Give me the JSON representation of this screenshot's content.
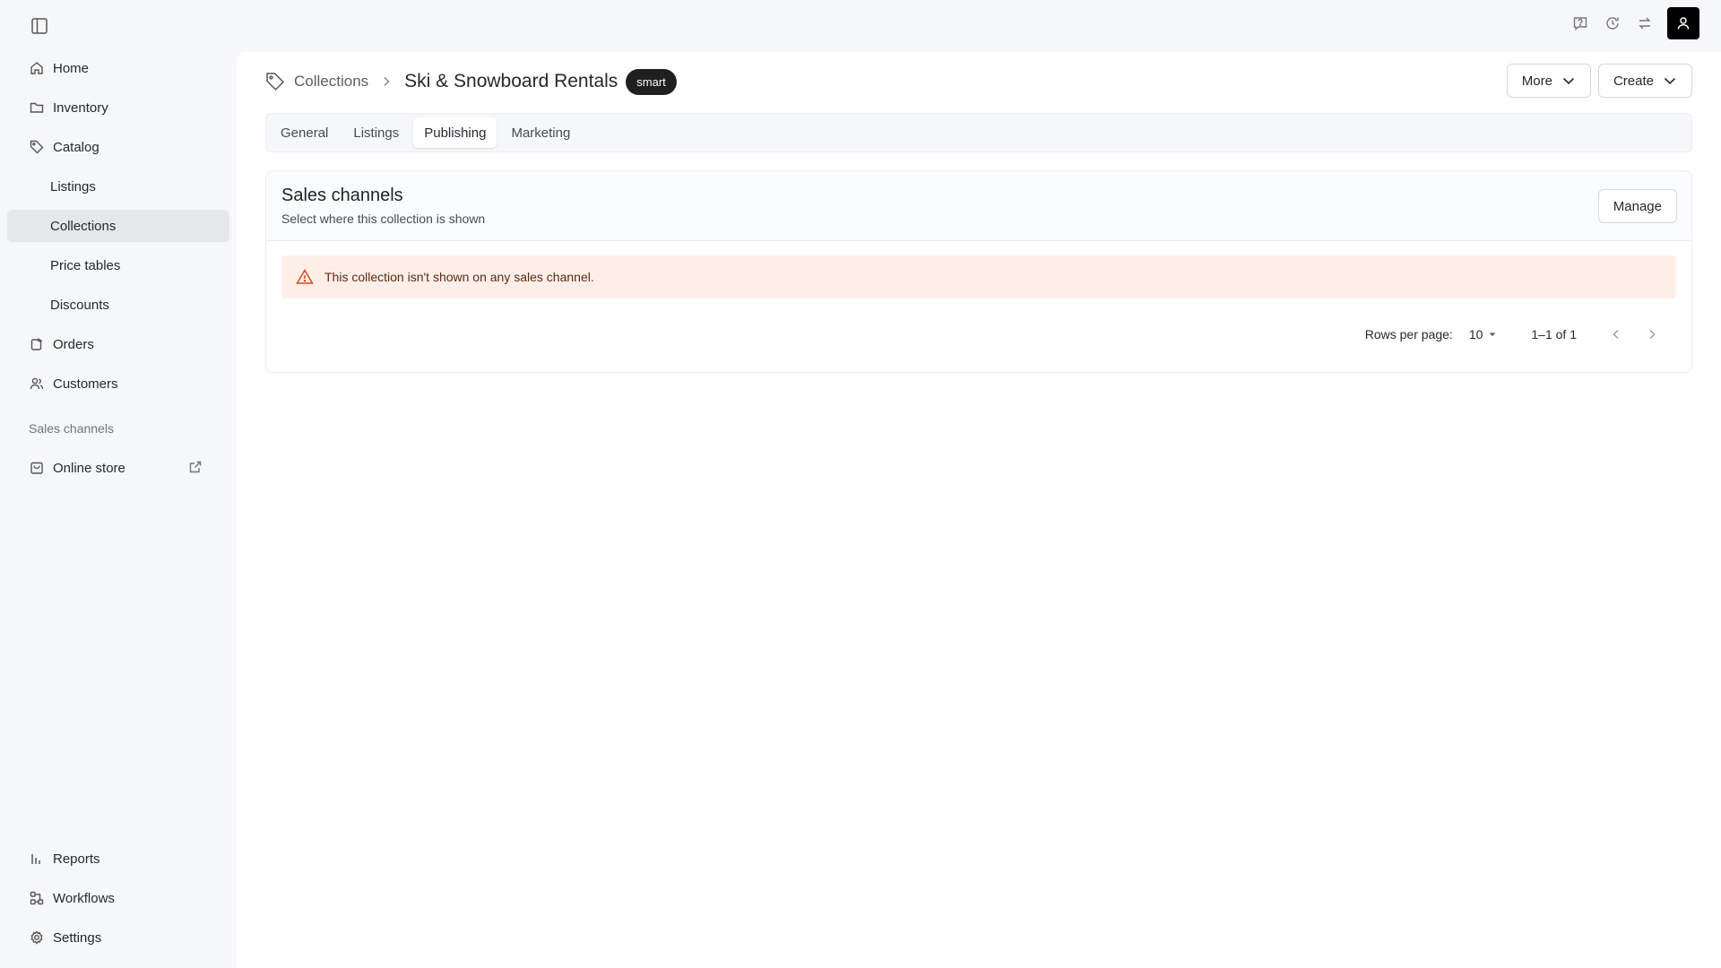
{
  "sidebar": {
    "items": [
      {
        "label": "Home",
        "icon": "home-icon"
      },
      {
        "label": "Inventory",
        "icon": "folder-icon"
      },
      {
        "label": "Catalog",
        "icon": "tag-icon"
      },
      {
        "label": "Listings"
      },
      {
        "label": "Collections",
        "active": true
      },
      {
        "label": "Price tables"
      },
      {
        "label": "Discounts"
      },
      {
        "label": "Orders",
        "icon": "orders-icon"
      },
      {
        "label": "Customers",
        "icon": "users-icon"
      }
    ],
    "section_label": "Sales channels",
    "online_store": "Online store",
    "bottom": [
      {
        "label": "Reports",
        "icon": "chart-icon"
      },
      {
        "label": "Workflows",
        "icon": "workflow-icon"
      },
      {
        "label": "Settings",
        "icon": "gear-icon"
      }
    ]
  },
  "header": {
    "breadcrumb": "Collections",
    "title": "Ski & Snowboard Rentals",
    "badge": "smart",
    "more_label": "More",
    "create_label": "Create"
  },
  "tabs": [
    "General",
    "Listings",
    "Publishing",
    "Marketing"
  ],
  "active_tab": "Publishing",
  "card": {
    "title": "Sales channels",
    "subtitle": "Select where this collection is shown",
    "manage_label": "Manage",
    "alert": "This collection isn't shown on any sales channel."
  },
  "pagination": {
    "rows_label": "Rows per page:",
    "rows_value": "10",
    "range": "1–1 of 1"
  },
  "colors": {
    "accent": "#000000",
    "alert_bg": "#fdefe8",
    "alert_icon": "#d44a1f"
  }
}
